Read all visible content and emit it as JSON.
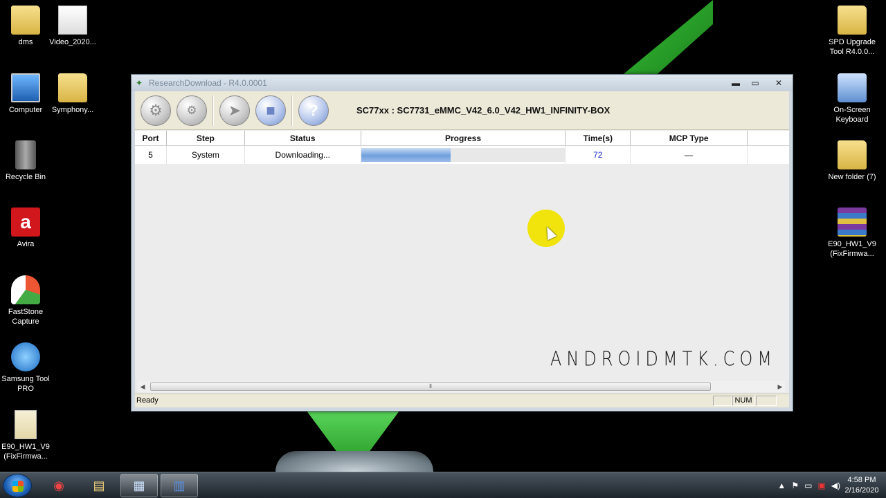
{
  "desktop_icons": [
    {
      "label": "dms",
      "icon": "folder-person-icon"
    },
    {
      "label": "Video_2020...",
      "icon": "video-file-icon"
    },
    {
      "label": "Computer",
      "icon": "computer-icon"
    },
    {
      "label": "Symphony...",
      "icon": "folder-icon"
    },
    {
      "label": "Recycle Bin",
      "icon": "recycle-bin-icon"
    },
    {
      "label": "Avira",
      "icon": "avira-icon"
    },
    {
      "label": "FastStone Capture",
      "icon": "faststone-icon"
    },
    {
      "label": "Samsung Tool PRO",
      "icon": "samsung-tool-icon"
    },
    {
      "label": "E90_HW1_V9 (FixFirmwa...",
      "icon": "document-icon"
    },
    {
      "label": "SPD Upgrade Tool R4.0.0...",
      "icon": "folder-icon"
    },
    {
      "label": "On-Screen Keyboard",
      "icon": "keyboard-icon"
    },
    {
      "label": "New folder (7)",
      "icon": "folder-icon"
    },
    {
      "label": "E90_HW1_V9 (FixFirmwa...",
      "icon": "winrar-icon"
    }
  ],
  "window": {
    "title": "ResearchDownload - R4.0.0001",
    "minimize": "▬",
    "maximize": "▭",
    "close": "✕",
    "toolbar": {
      "buttons": [
        {
          "name": "settings-button",
          "icon": "gear-icon",
          "glyph": "⚙"
        },
        {
          "name": "load-packet-button",
          "icon": "gears-icon",
          "glyph": "⚙"
        },
        {
          "name": "start-download-button",
          "icon": "play-icon",
          "glyph": "➤"
        },
        {
          "name": "stop-download-button",
          "icon": "stop-icon",
          "glyph": "■"
        },
        {
          "name": "help-button",
          "icon": "question-icon",
          "glyph": "?"
        }
      ],
      "product_title": "SC77xx : SC7731_eMMC_V42_6.0_V42_HW1_INFINITY-BOX"
    },
    "grid": {
      "columns": [
        "Port",
        "Step",
        "Status",
        "Progress",
        "Time(s)",
        "MCP Type"
      ],
      "rows": [
        {
          "port": "5",
          "step": "System",
          "status": "Downloading...",
          "progress": 0.44,
          "time": "72",
          "mcp": "—"
        }
      ]
    },
    "watermark": "ANDROIDMTK.COM",
    "status_bar": {
      "text": "Ready",
      "num": "NUM"
    }
  },
  "taskbar": {
    "items": [
      {
        "name": "chrome-icon",
        "glyph": "◉"
      },
      {
        "name": "file-explorer-icon",
        "glyph": "▤"
      },
      {
        "name": "research-download-icon",
        "glyph": "▦"
      },
      {
        "name": "spd-tool-icon",
        "glyph": "▥"
      }
    ],
    "time": "4:58 PM",
    "date": "2/16/2020"
  },
  "colors": {
    "accent": "#6f9fdc",
    "time_value": "#1a2ccf",
    "taskbar": "#1d242b"
  }
}
